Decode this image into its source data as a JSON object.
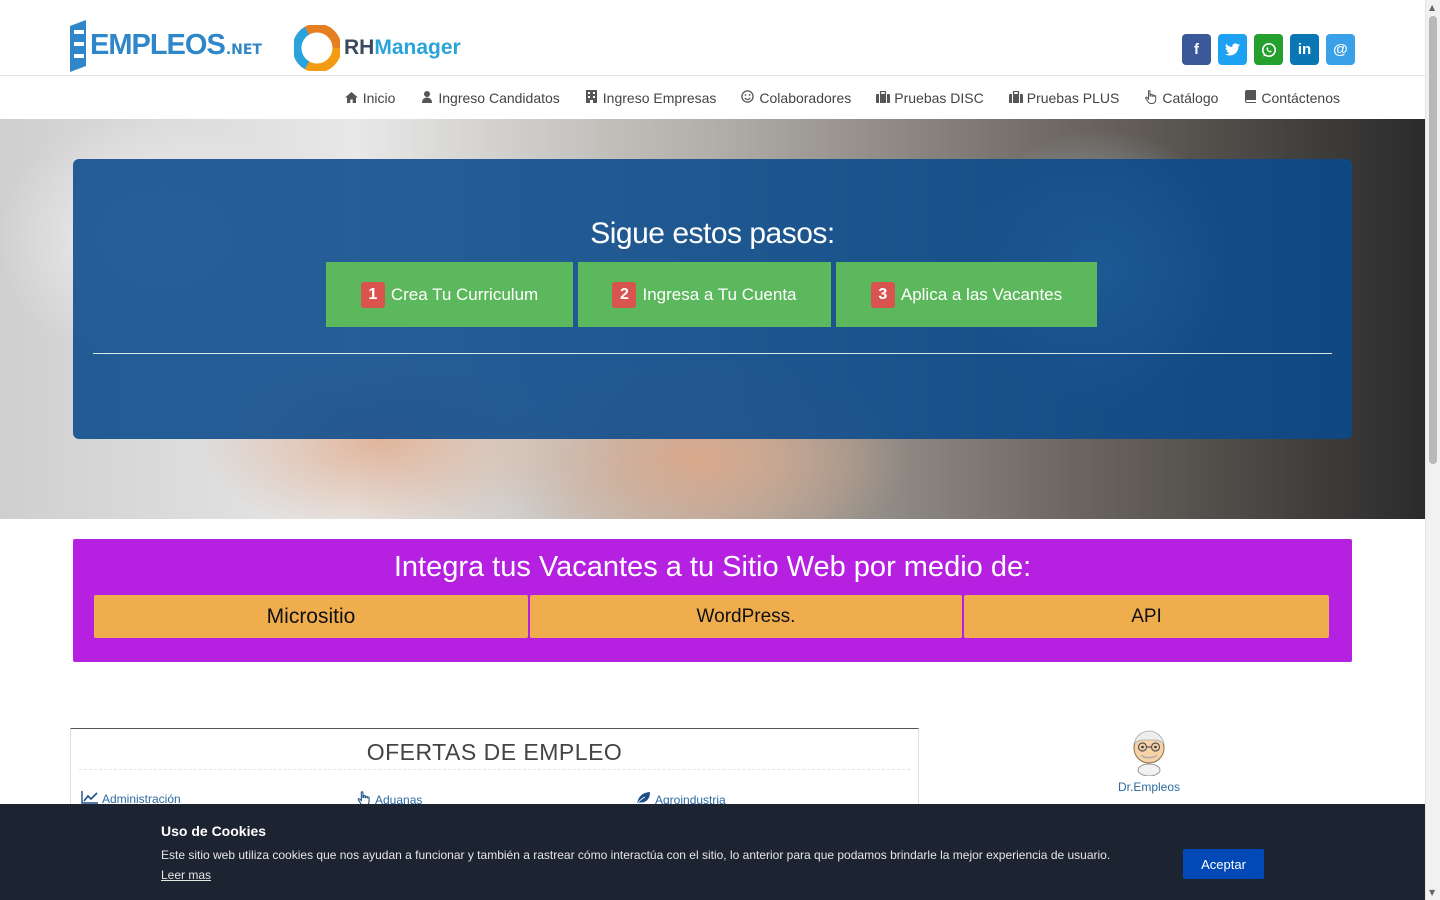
{
  "header": {
    "logo_empleos": "EMPLEOS",
    "logo_empleos_suffix": ".NET",
    "logo_rh_prefix": "RH",
    "logo_rh_suffix": "Manager",
    "social": [
      {
        "name": "facebook-icon",
        "glyph": "f",
        "color": "#3b5998"
      },
      {
        "name": "twitter-icon",
        "glyph": "t",
        "color": "#1da1f2"
      },
      {
        "name": "whatsapp-icon",
        "glyph": "w",
        "color": "#25a02f"
      },
      {
        "name": "linkedin-icon",
        "glyph": "in",
        "color": "#0a77b5"
      },
      {
        "name": "email-icon",
        "glyph": "@",
        "color": "#3aa0e8"
      }
    ]
  },
  "nav": [
    {
      "label": "Inicio",
      "icon": "home-icon"
    },
    {
      "label": "Ingreso Candidatos",
      "icon": "user-icon"
    },
    {
      "label": "Ingreso Empresas",
      "icon": "building-icon"
    },
    {
      "label": "Colaboradores",
      "icon": "smile-icon"
    },
    {
      "label": "Pruebas DISC",
      "icon": "briefcase-icon"
    },
    {
      "label": "Pruebas PLUS",
      "icon": "briefcase-icon"
    },
    {
      "label": "Catálogo",
      "icon": "hand-pointer-icon"
    },
    {
      "label": "Contáctenos",
      "icon": "book-icon"
    }
  ],
  "hero": {
    "title": "Sigue estos pasos:",
    "steps": [
      {
        "num": "1",
        "label": "Crea Tu Curriculum"
      },
      {
        "num": "2",
        "label": "Ingresa a Tu Cuenta"
      },
      {
        "num": "3",
        "label": "Aplica a las Vacantes"
      }
    ]
  },
  "integra": {
    "title": "Integra tus Vacantes a tu Sitio Web por medio de:",
    "options": [
      "Micrositio",
      "WordPress.",
      "API"
    ]
  },
  "ofertas": {
    "title": "OFERTAS DE EMPLEO",
    "categories": [
      {
        "label": "Administración",
        "icon": "line-chart-icon"
      },
      {
        "label": "Aduanas",
        "icon": "hand-pointer-icon"
      },
      {
        "label": "Agroindustria",
        "icon": "leaf-icon"
      }
    ]
  },
  "dr": {
    "label": "Dr.Empleos"
  },
  "cookie": {
    "title": "Uso de Cookies",
    "text": "Este sitio web utiliza cookies que nos ayudan a funcionar y también a rastrear cómo interactúa con el sitio, lo anterior para que podamos brindarle la mejor experiencia de usuario.",
    "link": "Leer mas",
    "button": "Aceptar"
  }
}
